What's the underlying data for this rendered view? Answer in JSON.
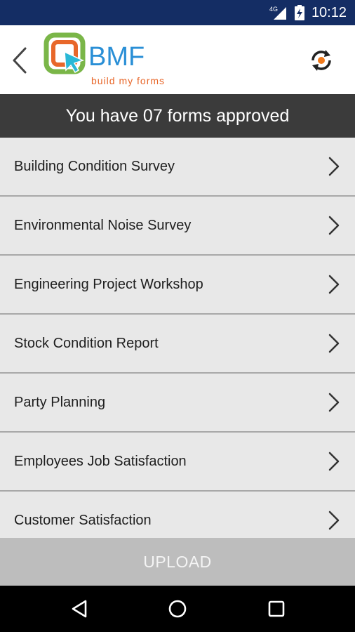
{
  "status_bar": {
    "network": "4G",
    "time": "10:12"
  },
  "header": {
    "logo_text": "BMF",
    "logo_tagline": "build my forms"
  },
  "banner": {
    "text": "You have 07 forms approved"
  },
  "forms": [
    {
      "label": "Building Condition Survey"
    },
    {
      "label": "Environmental Noise Survey"
    },
    {
      "label": "Engineering Project Workshop"
    },
    {
      "label": "Stock Condition Report"
    },
    {
      "label": "Party Planning"
    },
    {
      "label": "Employees Job Satisfaction"
    },
    {
      "label": "Customer Satisfaction"
    }
  ],
  "upload": {
    "label": "UPLOAD"
  },
  "colors": {
    "status_bar": "#142d64",
    "banner": "#3b3b3b",
    "row_bg": "#e8e8e8",
    "upload_bg": "#bdbdbd",
    "logo_blue": "#2a8fd6",
    "logo_orange": "#e8672a",
    "logo_green": "#7ab648",
    "sync_orange": "#f07a1c"
  },
  "icons": {
    "back": "chevron-left-icon",
    "sync": "sync-icon",
    "row": "chevron-right-icon",
    "nav": [
      "back-triangle-icon",
      "home-circle-icon",
      "recents-square-icon"
    ]
  }
}
